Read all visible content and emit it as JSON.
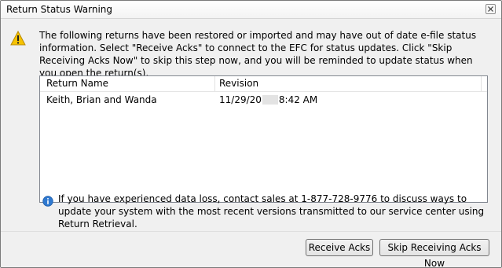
{
  "window": {
    "title": "Return Status Warning",
    "close_icon": "close-icon"
  },
  "message": {
    "icon": "warning-icon",
    "text": "The following returns have been restored or imported and may have out of date e-file status information. Select \"Receive Acks\" to connect to the EFC for status updates. Click \"Skip Receiving Acks Now\" to skip this step now, and you will be reminded to update status when you open the return(s)."
  },
  "list": {
    "columns": [
      "Return Name",
      "Revision"
    ],
    "rows": [
      {
        "return_name": "Keith, Brian and Wanda",
        "revision_prefix": "11/29/20",
        "revision_suffix": "8:42 AM"
      }
    ]
  },
  "note": {
    "icon": "info-icon",
    "text": "If you have experienced data loss, contact sales at 1-877-728-9776 to discuss ways to update your system with the most recent versions transmitted to our service center using Return Retrieval."
  },
  "buttons": {
    "receive_acks": "Receive Acks",
    "skip": "Skip Receiving Acks Now"
  },
  "colors": {
    "warning_yellow": "#f6c200",
    "info_blue": "#2f79d0",
    "window_bg": "#f0f0f0"
  }
}
